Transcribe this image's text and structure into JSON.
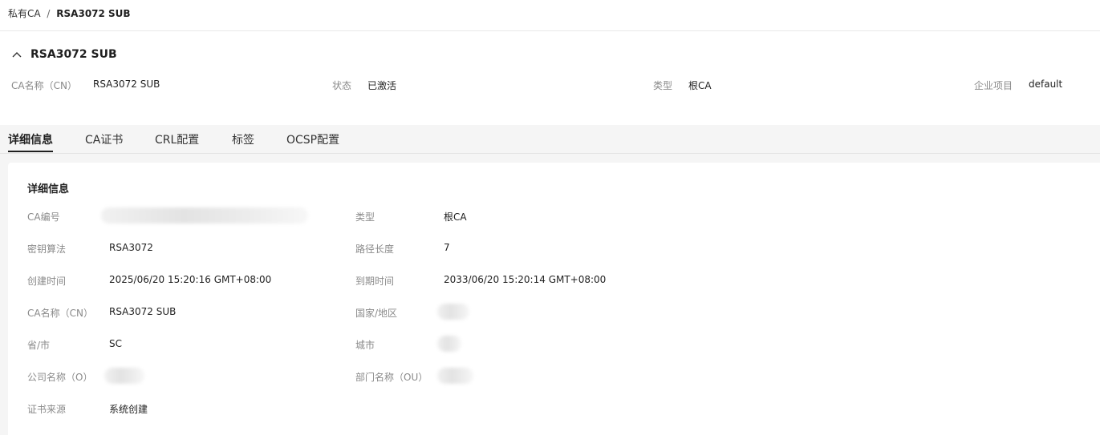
{
  "breadcrumb": {
    "parent": "私有CA",
    "separator": "/",
    "current": "RSA3072 SUB"
  },
  "header": {
    "title": "RSA3072 SUB"
  },
  "summary": {
    "cn_label": "CA名称（CN）",
    "cn_value": "RSA3072 SUB",
    "status_label": "状态",
    "status_value": "已激活",
    "type_label": "类型",
    "type_value": "根CA",
    "project_label": "企业项目",
    "project_value": "default"
  },
  "tabs": [
    {
      "label": "详细信息"
    },
    {
      "label": "CA证书"
    },
    {
      "label": "CRL配置"
    },
    {
      "label": "标签"
    },
    {
      "label": "OCSP配置"
    }
  ],
  "details": {
    "title": "详细信息",
    "ca_id_label": "CA编号",
    "key_algo_label": "密钥算法",
    "key_algo_value": "RSA3072",
    "created_label": "创建时间",
    "created_value": "2025/06/20 15:20:16 GMT+08:00",
    "cn_label": "CA名称（CN）",
    "cn_value": "RSA3072 SUB",
    "province_label": "省/市",
    "province_value": "SC",
    "org_label": "公司名称（O）",
    "source_label": "证书来源",
    "source_value": "系统创建",
    "type_label": "类型",
    "type_value": "根CA",
    "path_label": "路径长度",
    "path_value": "7",
    "expiry_label": "到期时间",
    "expiry_value": "2033/06/20 15:20:14 GMT+08:00",
    "country_label": "国家/地区",
    "city_label": "城市",
    "ou_label": "部门名称（OU）"
  }
}
